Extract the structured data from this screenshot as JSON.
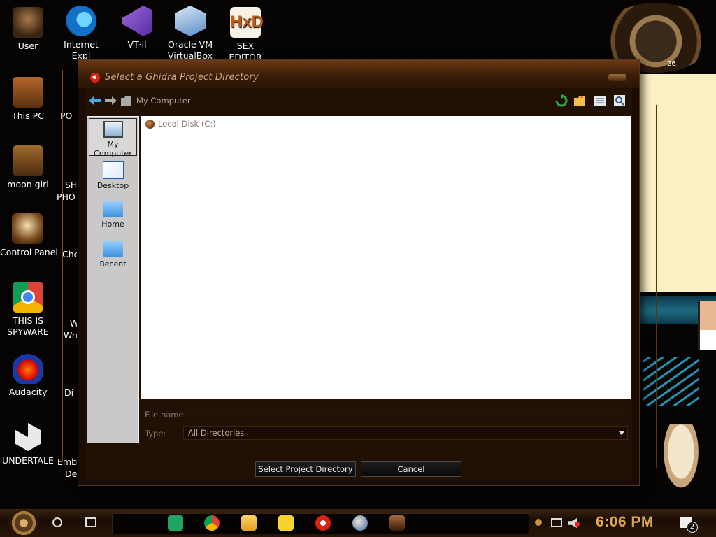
{
  "desktop": {
    "icons": [
      {
        "label": "User",
        "icon": "user-icon"
      },
      {
        "label": "Internet Explorer",
        "short": "Internet Expl",
        "icon": "edge-icon"
      },
      {
        "label": "VTrail",
        "short": "VT·il",
        "icon": "visual-studio-icon"
      },
      {
        "label": "Oracle VM VirtualBox",
        "line1": "Oracle VM",
        "line2": "VirtualBox",
        "icon": "virtualbox-icon"
      },
      {
        "label": "SEX EDITOR",
        "line1": "SEX",
        "line2": "EDITOR",
        "icon": "hxd-icon"
      },
      {
        "label": "This PC",
        "icon": "computer-icon"
      },
      {
        "label": "moon girl",
        "icon": "folder-icon"
      },
      {
        "label": "Control Panel",
        "icon": "control-panel-icon"
      },
      {
        "label": "THIS IS SPYWARE",
        "line1": "THIS IS",
        "line2": "SPYWARE",
        "icon": "chrome-icon"
      },
      {
        "label": "Audacity",
        "icon": "audacity-icon"
      },
      {
        "label": "UNDERTALE",
        "icon": "unity-icon"
      }
    ],
    "partial_labels": {
      "po": "PO",
      "sh": "SH",
      "phot": "PHOT",
      "chom": "Chom",
      "w": "W",
      "wre": "Wre",
      "di": "Di",
      "emba": "Emba",
      "dev": "Dev"
    },
    "clock_day": "26"
  },
  "dialog": {
    "title": "Select a Ghidra Project Directory",
    "breadcrumb": "My Computer",
    "places": [
      {
        "label": "My Computer",
        "icon": "computer-icon",
        "selected": true
      },
      {
        "label": "Desktop",
        "icon": "desktop-icon",
        "selected": false
      },
      {
        "label": "Home",
        "icon": "home-folder-icon",
        "selected": false
      },
      {
        "label": "Recent",
        "icon": "recent-folder-icon",
        "selected": false
      }
    ],
    "files": [
      {
        "name": "Local Disk (C:)",
        "icon": "disk-icon"
      }
    ],
    "filename_label": "File name:",
    "filename_value": "",
    "type_label": "Type:",
    "type_value": "All Directories",
    "select_button": "Select Project Directory",
    "cancel_button": "Cancel"
  },
  "taskbar": {
    "time": "6:06 PM",
    "notification_count": "2",
    "apps": [
      "sheets-icon",
      "chrome-icon",
      "file-explorer-icon",
      "sticky-notes-icon",
      "ghidra-icon",
      "paint-icon",
      "java-icon"
    ]
  },
  "colors": {
    "clock": "#e0a84a",
    "dialog_frame": "#1a0c04",
    "file_list_bg": "#ffffff"
  }
}
